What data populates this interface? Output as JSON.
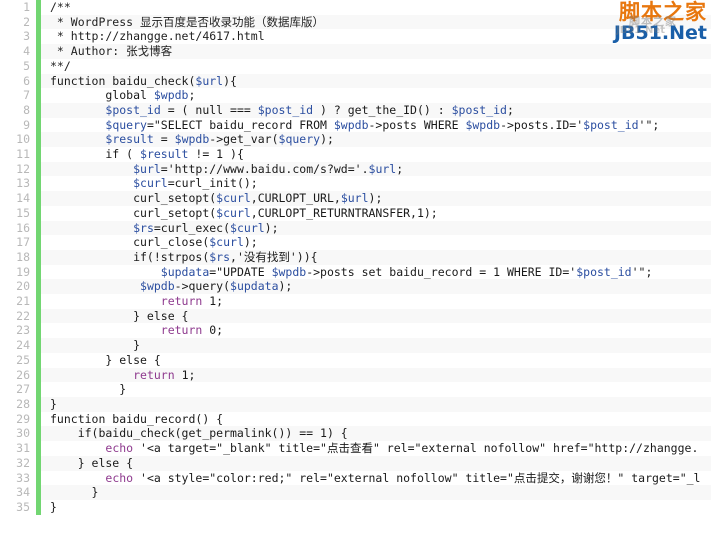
{
  "watermark": {
    "cn": "脚本之家",
    "en": "JB51.Net",
    "ghost_cn": "脚本之家",
    "ghost_en": "JB51.Net",
    "color_cn": "#e8770e",
    "color_en": "#1a5fa8"
  },
  "editor": {
    "language": "PHP",
    "gutter_bar_color": "#72d672",
    "line_number_color": "#b8b8b8",
    "stripe_color": "#f8f8f8",
    "background": "#ffffff",
    "total_lines": 35
  },
  "code": {
    "lines": [
      {
        "n": "1",
        "tokens": [
          {
            "t": "com",
            "v": "/**"
          }
        ]
      },
      {
        "n": "2",
        "tokens": [
          {
            "t": "com",
            "v": " * WordPress 显示百度是否收录功能（数据库版）"
          }
        ]
      },
      {
        "n": "3",
        "tokens": [
          {
            "t": "com",
            "v": " * http://zhangge.net/4617.html"
          }
        ]
      },
      {
        "n": "4",
        "tokens": [
          {
            "t": "com",
            "v": " * Author: 张戈博客"
          }
        ]
      },
      {
        "n": "5",
        "tokens": [
          {
            "t": "com",
            "v": "**/"
          }
        ]
      },
      {
        "n": "6",
        "tokens": [
          {
            "t": "pln",
            "v": "function baidu_check("
          },
          {
            "t": "var",
            "v": "$url"
          },
          {
            "t": "pln",
            "v": "){"
          }
        ]
      },
      {
        "n": "7",
        "tokens": [
          {
            "t": "pln",
            "v": "        global "
          },
          {
            "t": "var",
            "v": "$wpdb"
          },
          {
            "t": "pln",
            "v": ";"
          }
        ]
      },
      {
        "n": "8",
        "tokens": [
          {
            "t": "pln",
            "v": "        "
          },
          {
            "t": "var",
            "v": "$post_id"
          },
          {
            "t": "pln",
            "v": " = ( null === "
          },
          {
            "t": "var",
            "v": "$post_id"
          },
          {
            "t": "pln",
            "v": " ) ? get_the_ID() : "
          },
          {
            "t": "var",
            "v": "$post_id"
          },
          {
            "t": "pln",
            "v": ";"
          }
        ]
      },
      {
        "n": "9",
        "tokens": [
          {
            "t": "pln",
            "v": "        "
          },
          {
            "t": "var",
            "v": "$query"
          },
          {
            "t": "pln",
            "v": "=\"SELECT baidu_record FROM "
          },
          {
            "t": "var",
            "v": "$wpdb"
          },
          {
            "t": "pln",
            "v": "->posts WHERE "
          },
          {
            "t": "var",
            "v": "$wpdb"
          },
          {
            "t": "pln",
            "v": "->posts.ID='"
          },
          {
            "t": "var",
            "v": "$post_id"
          },
          {
            "t": "pln",
            "v": "'\";"
          }
        ]
      },
      {
        "n": "10",
        "tokens": [
          {
            "t": "pln",
            "v": "        "
          },
          {
            "t": "var",
            "v": "$result"
          },
          {
            "t": "pln",
            "v": " = "
          },
          {
            "t": "var",
            "v": "$wpdb"
          },
          {
            "t": "pln",
            "v": "->get_var("
          },
          {
            "t": "var",
            "v": "$query"
          },
          {
            "t": "pln",
            "v": ");"
          }
        ]
      },
      {
        "n": "11",
        "tokens": [
          {
            "t": "pln",
            "v": "        if ( "
          },
          {
            "t": "var",
            "v": "$result"
          },
          {
            "t": "pln",
            "v": " != 1 ){"
          }
        ]
      },
      {
        "n": "12",
        "tokens": [
          {
            "t": "pln",
            "v": "            "
          },
          {
            "t": "var",
            "v": "$url"
          },
          {
            "t": "pln",
            "v": "='http://www.baidu.com/s?wd='."
          },
          {
            "t": "var",
            "v": "$url"
          },
          {
            "t": "pln",
            "v": ";"
          }
        ]
      },
      {
        "n": "13",
        "tokens": [
          {
            "t": "pln",
            "v": "            "
          },
          {
            "t": "var",
            "v": "$curl"
          },
          {
            "t": "pln",
            "v": "=curl_init();"
          }
        ]
      },
      {
        "n": "14",
        "tokens": [
          {
            "t": "pln",
            "v": "            curl_setopt("
          },
          {
            "t": "var",
            "v": "$curl"
          },
          {
            "t": "pln",
            "v": ",CURLOPT_URL,"
          },
          {
            "t": "var",
            "v": "$url"
          },
          {
            "t": "pln",
            "v": ");"
          }
        ]
      },
      {
        "n": "15",
        "tokens": [
          {
            "t": "pln",
            "v": "            curl_setopt("
          },
          {
            "t": "var",
            "v": "$curl"
          },
          {
            "t": "pln",
            "v": ",CURLOPT_RETURNTRANSFER,1);"
          }
        ]
      },
      {
        "n": "16",
        "tokens": [
          {
            "t": "pln",
            "v": "            "
          },
          {
            "t": "var",
            "v": "$rs"
          },
          {
            "t": "pln",
            "v": "=curl_exec("
          },
          {
            "t": "var",
            "v": "$curl"
          },
          {
            "t": "pln",
            "v": ");"
          }
        ]
      },
      {
        "n": "17",
        "tokens": [
          {
            "t": "pln",
            "v": "            curl_close("
          },
          {
            "t": "var",
            "v": "$curl"
          },
          {
            "t": "pln",
            "v": ");"
          }
        ]
      },
      {
        "n": "18",
        "tokens": [
          {
            "t": "pln",
            "v": "            if(!strpos("
          },
          {
            "t": "var",
            "v": "$rs"
          },
          {
            "t": "pln",
            "v": ",'没有找到')){"
          }
        ]
      },
      {
        "n": "19",
        "tokens": [
          {
            "t": "pln",
            "v": "                "
          },
          {
            "t": "var",
            "v": "$updata"
          },
          {
            "t": "pln",
            "v": "=\"UPDATE "
          },
          {
            "t": "var",
            "v": "$wpdb"
          },
          {
            "t": "pln",
            "v": "->posts set baidu_record = 1 WHERE ID='"
          },
          {
            "t": "var",
            "v": "$post_id"
          },
          {
            "t": "pln",
            "v": "'\";"
          }
        ]
      },
      {
        "n": "20",
        "tokens": [
          {
            "t": "pln",
            "v": "             "
          },
          {
            "t": "var",
            "v": "$wpdb"
          },
          {
            "t": "pln",
            "v": "->query("
          },
          {
            "t": "var",
            "v": "$updata"
          },
          {
            "t": "pln",
            "v": ");"
          }
        ]
      },
      {
        "n": "21",
        "tokens": [
          {
            "t": "pln",
            "v": "                "
          },
          {
            "t": "kw",
            "v": "return"
          },
          {
            "t": "pln",
            "v": " 1;"
          }
        ]
      },
      {
        "n": "22",
        "tokens": [
          {
            "t": "pln",
            "v": "            } else {"
          }
        ]
      },
      {
        "n": "23",
        "tokens": [
          {
            "t": "pln",
            "v": "                "
          },
          {
            "t": "kw",
            "v": "return"
          },
          {
            "t": "pln",
            "v": " 0;"
          }
        ]
      },
      {
        "n": "24",
        "tokens": [
          {
            "t": "pln",
            "v": "            }"
          }
        ]
      },
      {
        "n": "25",
        "tokens": [
          {
            "t": "pln",
            "v": "        } else {"
          }
        ]
      },
      {
        "n": "26",
        "tokens": [
          {
            "t": "pln",
            "v": "            "
          },
          {
            "t": "kw",
            "v": "return"
          },
          {
            "t": "pln",
            "v": " 1;"
          }
        ]
      },
      {
        "n": "27",
        "tokens": [
          {
            "t": "pln",
            "v": "          }"
          }
        ]
      },
      {
        "n": "28",
        "tokens": [
          {
            "t": "pln",
            "v": "}"
          }
        ]
      },
      {
        "n": "29",
        "tokens": [
          {
            "t": "pln",
            "v": "function baidu_record() {"
          }
        ]
      },
      {
        "n": "30",
        "tokens": [
          {
            "t": "pln",
            "v": "    if(baidu_check(get_permalink()) == 1) {"
          }
        ]
      },
      {
        "n": "31",
        "tokens": [
          {
            "t": "pln",
            "v": "        "
          },
          {
            "t": "kw",
            "v": "echo"
          },
          {
            "t": "pln",
            "v": " '<a target=\"_blank\" title=\"点击查看\" rel=\"external nofollow\" href=\"http://zhangge."
          }
        ]
      },
      {
        "n": "32",
        "tokens": [
          {
            "t": "pln",
            "v": "    } else {"
          }
        ]
      },
      {
        "n": "33",
        "tokens": [
          {
            "t": "pln",
            "v": "        "
          },
          {
            "t": "kw",
            "v": "echo"
          },
          {
            "t": "pln",
            "v": " '<a style=\"color:red;\" rel=\"external nofollow\" title=\"点击提交，谢谢您！\" target=\"_l"
          }
        ]
      },
      {
        "n": "34",
        "tokens": [
          {
            "t": "pln",
            "v": "      }"
          }
        ]
      },
      {
        "n": "35",
        "tokens": [
          {
            "t": "pln",
            "v": "}"
          }
        ]
      }
    ]
  }
}
